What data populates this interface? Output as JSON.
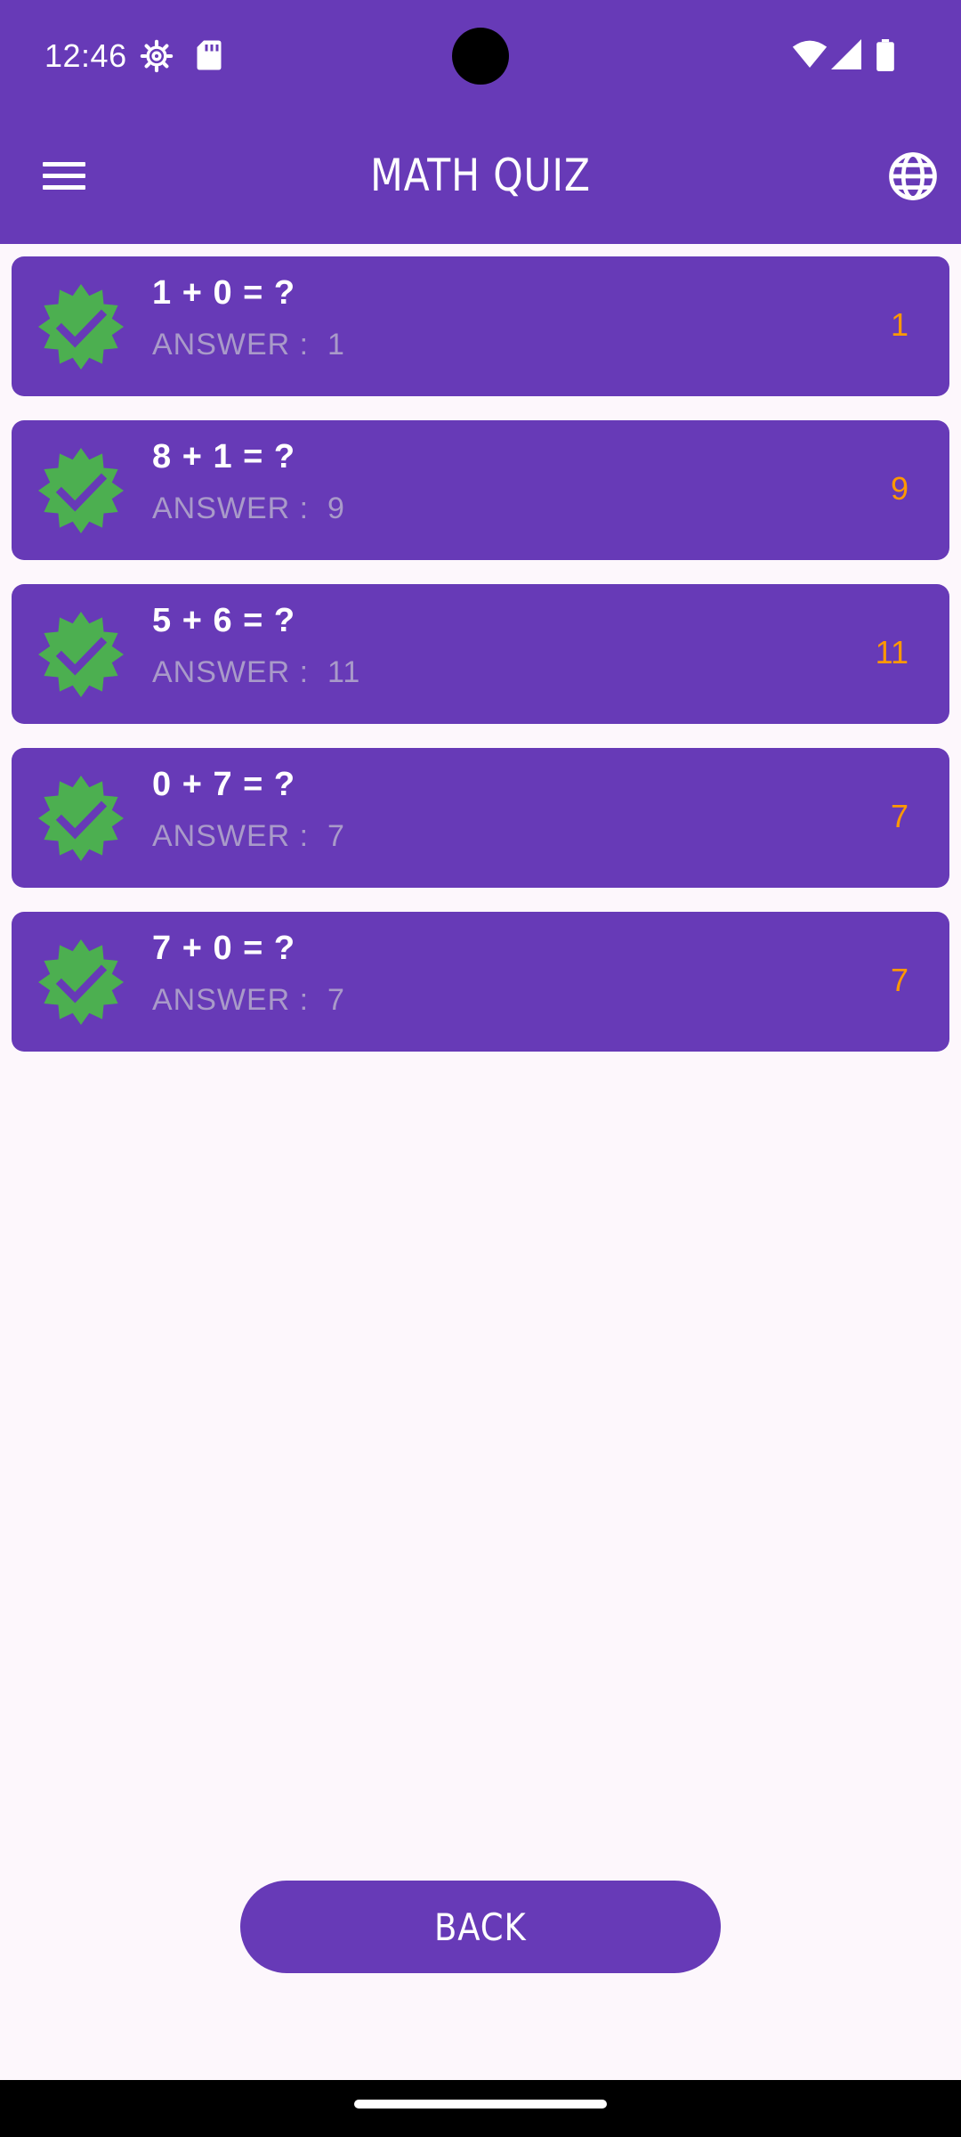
{
  "status_bar": {
    "time": "12:46",
    "icons": [
      "settings-icon",
      "sd-card-icon",
      "wifi-icon",
      "signal-icon",
      "battery-icon"
    ]
  },
  "app_bar": {
    "title": "MATH QUIZ",
    "menu_icon": "hamburger-menu-icon",
    "language_icon": "globe-icon"
  },
  "answer_prefix": "ANSWER :  ",
  "quiz_items": [
    {
      "question": "1 + 0 = ?",
      "answer_text": "ANSWER :  1",
      "user_answer": "1",
      "status_icon": "verified-check-icon"
    },
    {
      "question": "8 + 1 = ?",
      "answer_text": "ANSWER :  9",
      "user_answer": "9",
      "status_icon": "verified-check-icon"
    },
    {
      "question": "5 + 6 = ?",
      "answer_text": "ANSWER :  11",
      "user_answer": "11",
      "status_icon": "verified-check-icon"
    },
    {
      "question": "0 + 7 = ?",
      "answer_text": "ANSWER :  7",
      "user_answer": "7",
      "status_icon": "verified-check-icon"
    },
    {
      "question": "7 + 0 = ?",
      "answer_text": "ANSWER :  7",
      "user_answer": "7",
      "status_icon": "verified-check-icon"
    }
  ],
  "back_button": {
    "label": "BACK"
  },
  "colors": {
    "primary": "#673ab7",
    "background": "#fdf7fc",
    "badge_green": "#4caf50",
    "user_answer": "#ff9800",
    "answer_label": "#a99ac9"
  }
}
